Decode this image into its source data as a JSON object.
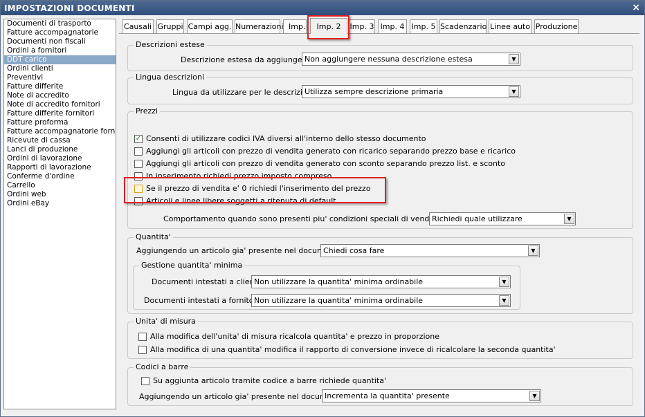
{
  "window": {
    "title": "IMPOSTAZIONI DOCUMENTI",
    "close_glyph": "×"
  },
  "sidebar": {
    "items": [
      {
        "label": "Documenti di trasporto"
      },
      {
        "label": "Fatture accompagnatorie"
      },
      {
        "label": "Documenti non fiscali"
      },
      {
        "label": "Ordini a fornitori"
      },
      {
        "label": "DDT carico"
      },
      {
        "label": "Ordini clienti"
      },
      {
        "label": "Preventivi"
      },
      {
        "label": "Fatture differite"
      },
      {
        "label": "Note di accredito"
      },
      {
        "label": "Note di accredito fornitori"
      },
      {
        "label": "Fatture differite fornitori"
      },
      {
        "label": "Fatture proforma"
      },
      {
        "label": "Fatture accompagnatorie fornito"
      },
      {
        "label": "Ricevute di cassa"
      },
      {
        "label": "Lanci di produzione"
      },
      {
        "label": "Ordini di lavorazione"
      },
      {
        "label": "Rapporti di lavorazione"
      },
      {
        "label": "Conferme d'ordine"
      },
      {
        "label": "Carrello"
      },
      {
        "label": "Ordini web"
      },
      {
        "label": "Ordini eBay"
      }
    ],
    "selected": "DDT carico"
  },
  "tabs": [
    {
      "label": "Causali"
    },
    {
      "label": "Gruppi"
    },
    {
      "label": "Campi agg."
    },
    {
      "label": "Numerazioni"
    },
    {
      "label": "Imp. 1"
    },
    {
      "label": "Imp. 2"
    },
    {
      "label": "Imp. 3"
    },
    {
      "label": "Imp. 4"
    },
    {
      "label": "Imp. 5"
    },
    {
      "label": "Scadenzario"
    },
    {
      "label": "Linee auto"
    },
    {
      "label": "Produzione"
    }
  ],
  "active_tab": "Imp. 2",
  "descrizioni_estese": {
    "title": "Descrizioni estese",
    "label": "Descrizione estesa da aggiungere :",
    "value": "Non aggiungere nessuna descrizione estesa"
  },
  "lingua_descrizioni": {
    "title": "Lingua descrizioni",
    "label": "Lingua da utilizzare per le descrizioni :",
    "value": "Utilizza sempre descrizione primaria"
  },
  "prezzi": {
    "title": "Prezzi",
    "options": [
      {
        "label": "Consenti di utilizzare codici IVA diversi all'interno dello stesso documento",
        "checked": true
      },
      {
        "label": "Aggiungi gli articoli con prezzo di vendita generato con ricarico separando prezzo base e ricarico",
        "checked": false
      },
      {
        "label": "Aggiungi gli articoli con prezzo di vendita generato con sconto separando prezzo list. e sconto",
        "checked": false
      },
      {
        "label": "In inserimento richiedi prezzo imposto compreso",
        "checked": false
      },
      {
        "label": "Se il prezzo di vendita e' 0 richiedi l'inserimento del prezzo",
        "checked": false
      },
      {
        "label": "Articoli e linee libere soggetti a ritenuta di default",
        "checked": false
      }
    ],
    "condizioni_label": "Comportamento quando sono presenti piu' condizioni speciali di vendita valide :",
    "condizioni_value": "Richiedi quale utilizzare"
  },
  "quantita": {
    "title": "Quantita'",
    "label": "Aggiungendo un articolo gia' presente nel documento :",
    "value": "Chiedi cosa fare",
    "minima": {
      "title": "Gestione quantita' minima",
      "clienti_label": "Documenti intestati a clienti :",
      "clienti_value": "Non utilizzare la quantita' minima ordinabile",
      "fornitori_label": "Documenti intestati a fornitori :",
      "fornitori_value": "Non utilizzare la quantita' minima ordinabile"
    }
  },
  "unita_misura": {
    "title": "Unita' di misura",
    "options": [
      {
        "label": "Alla modifica dell'unita' di misura ricalcola quantita' e prezzo in proporzione",
        "checked": false
      },
      {
        "label": "Alla modifica di una quantita' modifica il rapporto di conversione invece di ricalcolare la seconda quantita'",
        "checked": false
      }
    ]
  },
  "codici_barre": {
    "title": "Codici a barre",
    "option": {
      "label": "Su aggiunta articolo tramite codice a barre richiede quantita'",
      "checked": false
    },
    "label": "Aggiungendo un articolo gia' presente nel documento :",
    "value": "Incrementa la quantita' presente"
  },
  "glyphs": {
    "check": "✓",
    "dropdown": "▼"
  },
  "colors": {
    "highlight": "#e02020",
    "selection": "#8aa8c8",
    "titlebar": "#3a5a86"
  }
}
